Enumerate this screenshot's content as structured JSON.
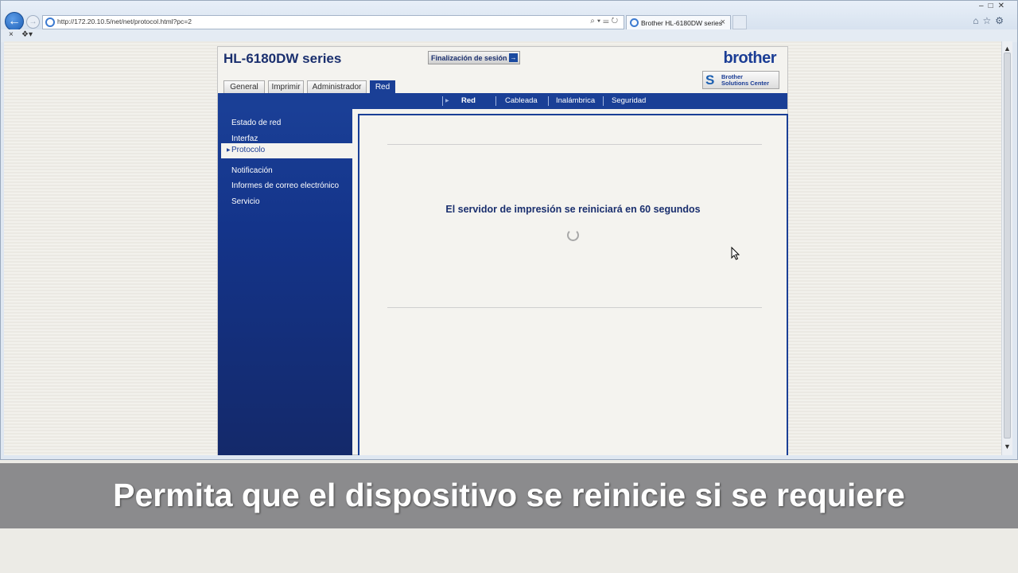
{
  "browser": {
    "url": "http://172.20.10.5/net/net/protocol.html?pc=2",
    "tab_title": "Brother HL-6180DW series",
    "icons": [
      "back-icon",
      "forward-icon",
      "search-icon",
      "refresh-icon",
      "home-icon",
      "star-icon",
      "gear-icon"
    ]
  },
  "page": {
    "model_title": "HL-6180DW series",
    "logout_label": "Finalización de sesión",
    "brand": "brother",
    "solutions_label_line1": "Brother",
    "solutions_label_line2": "Solutions Center",
    "tabs": [
      {
        "label": "General"
      },
      {
        "label": "Imprimir"
      },
      {
        "label": "Administrador"
      },
      {
        "label": "Red"
      }
    ],
    "subnav": [
      {
        "label": "Red"
      },
      {
        "label": "Cableada"
      },
      {
        "label": "Inalámbrica"
      },
      {
        "label": "Seguridad"
      }
    ],
    "sidebar": [
      {
        "label": "Estado de red"
      },
      {
        "label": "Interfaz"
      },
      {
        "label": "Protocolo"
      },
      {
        "label": "Notificación"
      },
      {
        "label": "Informes de correo electrónico"
      },
      {
        "label": "Servicio"
      }
    ],
    "message": "El servidor de impresión se reiniciará en 60 segundos"
  },
  "caption": "Permita que el dispositivo se reinicie si se requiere",
  "colors": {
    "brand_blue": "#1a3f96",
    "caption_bg": "#8b8b8d"
  }
}
